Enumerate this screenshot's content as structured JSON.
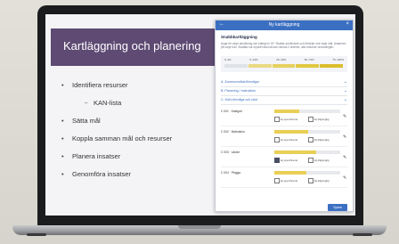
{
  "slide": {
    "title": "Kartläggning och planering",
    "bullets": [
      {
        "text": "Identifiera resurser",
        "level": 0
      },
      {
        "text": "KAN-lista",
        "level": 1
      },
      {
        "text": "Sätta mål",
        "level": 0
      },
      {
        "text": "Koppla samman mål och resurser",
        "level": 0
      },
      {
        "text": "Planera insatser",
        "level": 0
      },
      {
        "text": "Genomföra insatser",
        "level": 0
      }
    ]
  },
  "panel": {
    "title": "Ny kartläggning",
    "back_icon": "arrow-left-icon",
    "close_icon": "close-icon",
    "section_title": "Snabbkartläggning",
    "section_desc": "Ange för varje ansökning och kategori i KF. Skattar användare och fördelar mot varje mål. Anamnes på varje kort. Skattad hur mycket stöd så kan nämna 2 kriterier, alla resurser utvecklingen.",
    "scale_labels": [
      "0–4%",
      "5–24%",
      "25–49%",
      "50–74%",
      "75–100%"
    ],
    "scale_colors": [
      "#dfe3e8",
      "#e9d982",
      "#e6d160",
      "#e0c842",
      "#dabe2c"
    ],
    "accordion": [
      {
        "label": "A: Ämnesområde/förmågor"
      },
      {
        "label": "B: Planering / Instruktion"
      },
      {
        "label": "C: KAN-förmåga och stöd"
      }
    ],
    "items": [
      {
        "label": "C 001 · Kategori",
        "level": 0.38,
        "opt1": "Ej specificerat",
        "opt2": "Ej tillgänglig",
        "checked": false
      },
      {
        "label": "C 002 · Motivation",
        "level": 0.52,
        "opt1": "Ej specificerat",
        "opt2": "Ej tillgänglig",
        "checked": false
      },
      {
        "label": "C 003 · Lärare",
        "level": 0.64,
        "opt1": "Ej specificerat",
        "opt2": "Ej tillgänglig",
        "checked": true
      },
      {
        "label": "C 004 · Plugga",
        "level": 0.48,
        "opt1": "Ej specificerat",
        "opt2": "Ej tillgänglig",
        "checked": false
      }
    ],
    "save_label": "Spara"
  }
}
